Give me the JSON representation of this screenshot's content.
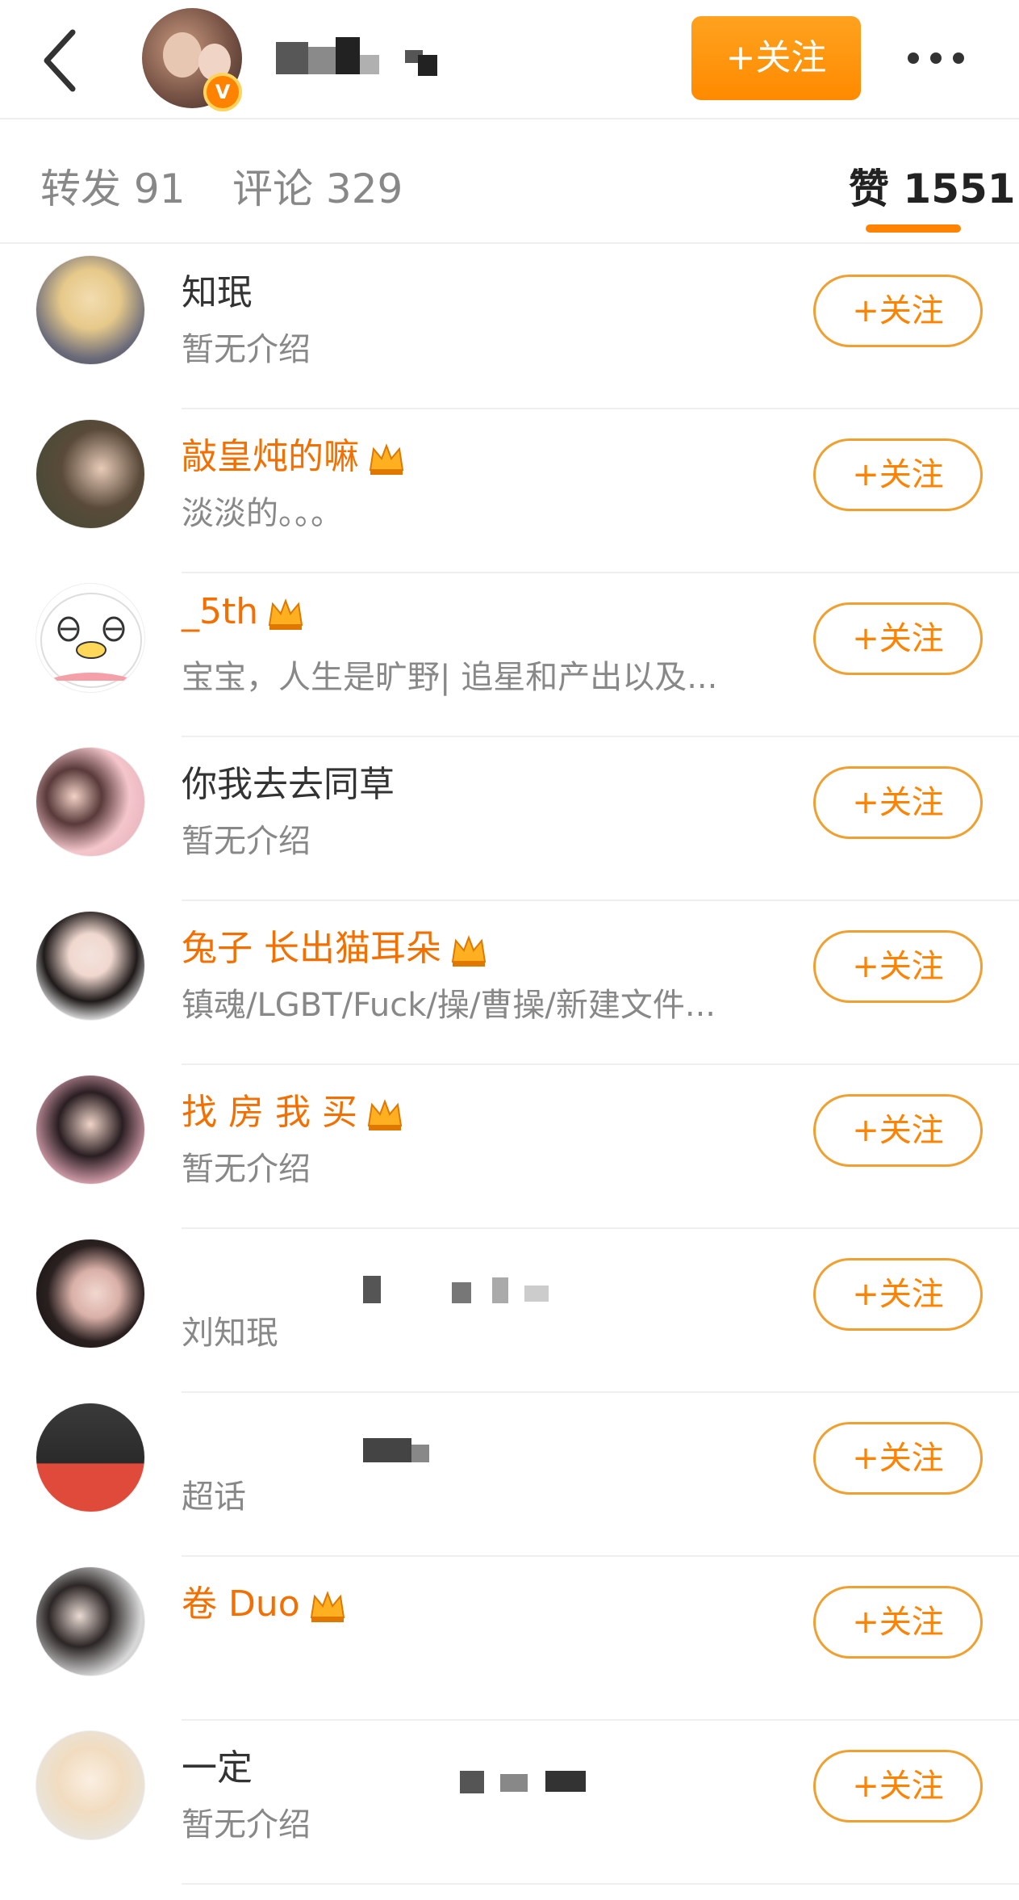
{
  "header": {
    "follow_label": "+关注",
    "more_icon": "more-dots-icon",
    "back_icon": "chevron-left-icon",
    "verified_mark": "V"
  },
  "tabs": {
    "repost": "转发 91",
    "comment": "评论 329",
    "like": "赞 1551"
  },
  "colors": {
    "accent": "#ff8200",
    "vip_name": "#f26f00",
    "muted": "#888888"
  },
  "users": [
    {
      "name": "知珉",
      "bio": "暂无介绍",
      "follow_label": "+关注",
      "vip": false,
      "crown": false
    },
    {
      "name": "敲皇炖的嘛",
      "bio": "淡淡的。。。",
      "follow_label": "+关注",
      "vip": true,
      "crown": true
    },
    {
      "name": "_5th",
      "bio": "宝宝，人生是旷野| 追星和产出以及...",
      "follow_label": "+关注",
      "vip": true,
      "crown": true
    },
    {
      "name": "你我去去同草",
      "bio": "暂无介绍",
      "follow_label": "+关注",
      "vip": false,
      "crown": false
    },
    {
      "name": "兔子 长出猫耳朵",
      "bio": "镇魂/LGBT/Fuck/操/曹操/新建文件...",
      "follow_label": "+关注",
      "vip": true,
      "crown": true
    },
    {
      "name": "找 房 我 买",
      "bio": "暂无介绍",
      "follow_label": "+关注",
      "vip": true,
      "crown": true
    },
    {
      "name": "",
      "bio": "刘知珉",
      "follow_label": "+关注",
      "vip": false,
      "crown": false
    },
    {
      "name": "",
      "bio": "超话",
      "follow_label": "+关注",
      "vip": false,
      "crown": false
    },
    {
      "name": "卷 Duo",
      "bio": "",
      "follow_label": "+关注",
      "vip": true,
      "crown": true
    },
    {
      "name": "一定",
      "bio": "暂无介绍",
      "follow_label": "+关注",
      "vip": false,
      "crown": false
    }
  ]
}
